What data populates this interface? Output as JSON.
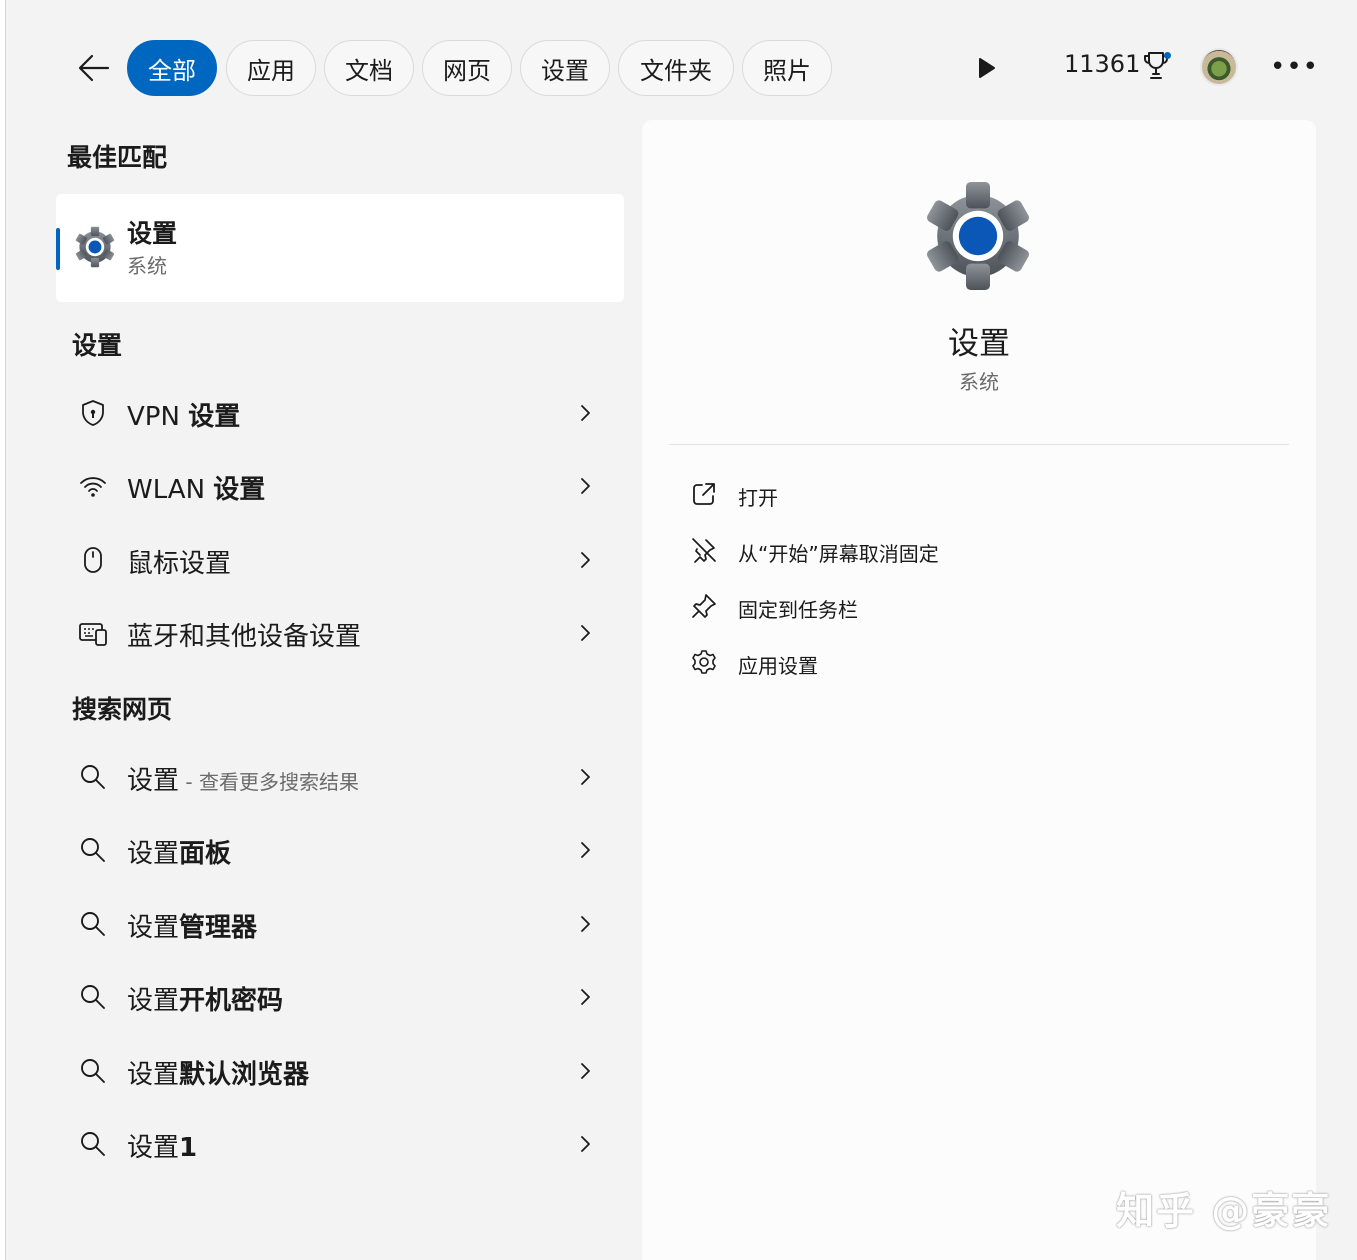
{
  "top_bar": {
    "filters": [
      {
        "label": "全部",
        "active": true
      },
      {
        "label": "应用",
        "active": false
      },
      {
        "label": "文档",
        "active": false
      },
      {
        "label": "网页",
        "active": false
      },
      {
        "label": "设置",
        "active": false
      },
      {
        "label": "文件夹",
        "active": false
      },
      {
        "label": "照片",
        "active": false
      }
    ],
    "points": "11361",
    "more_label": "•••"
  },
  "left": {
    "best_match_title": "最佳匹配",
    "best_match": {
      "title": "设置",
      "subtitle": "系统",
      "icon": "settings-gear-icon"
    },
    "settings_title": "设置",
    "settings_items": [
      {
        "label_normal": "VPN ",
        "label_bold": "设置",
        "icon": "shield-icon"
      },
      {
        "label_normal": "WLAN ",
        "label_bold": "设置",
        "icon": "wifi-icon"
      },
      {
        "label_normal": "鼠标设置",
        "label_bold": "",
        "icon": "mouse-icon"
      },
      {
        "label_normal": "蓝牙和其他设备设置",
        "label_bold": "",
        "icon": "devices-icon"
      }
    ],
    "web_title": "搜索网页",
    "web_items": [
      {
        "label_normal": "设置",
        "label_bold": "",
        "hint": " - 查看更多搜索结果"
      },
      {
        "label_normal": "设置",
        "label_bold": "面板",
        "hint": ""
      },
      {
        "label_normal": "设置",
        "label_bold": "管理器",
        "hint": ""
      },
      {
        "label_normal": "设置",
        "label_bold": "开机密码",
        "hint": ""
      },
      {
        "label_normal": "设置",
        "label_bold": "默认浏览器",
        "hint": ""
      },
      {
        "label_normal": "设置",
        "label_bold": "1",
        "hint": ""
      }
    ]
  },
  "detail": {
    "title": "设置",
    "subtitle": "系统",
    "actions": [
      {
        "label": "打开",
        "icon": "open-external-icon"
      },
      {
        "label": "从“开始”屏幕取消固定",
        "icon": "unpin-icon"
      },
      {
        "label": "固定到任务栏",
        "icon": "pin-icon"
      },
      {
        "label": "应用设置",
        "icon": "gear-outline-icon"
      }
    ]
  },
  "watermark": "知乎 @豪豪",
  "colors": {
    "accent": "#0067c0",
    "background": "#f3f3f3",
    "panel": "#fcfcfc"
  }
}
